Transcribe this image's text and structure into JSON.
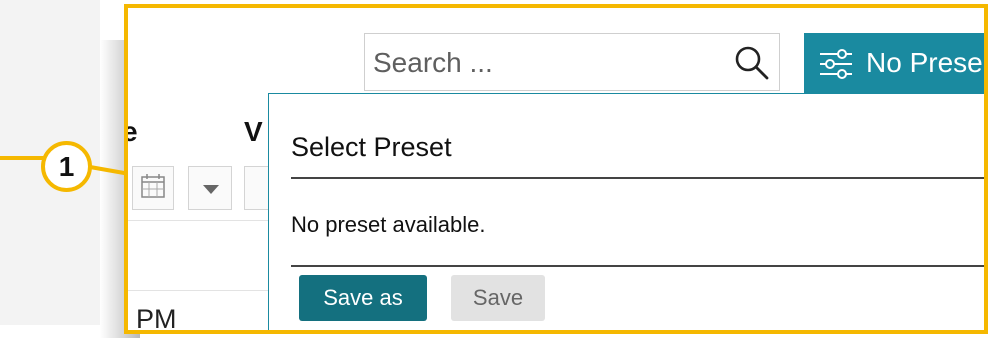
{
  "search": {
    "placeholder": "Search ..."
  },
  "preset_button": {
    "label": "No Prese"
  },
  "table": {
    "column_headers": [
      "e",
      "V"
    ],
    "row_text": "PM"
  },
  "callout": {
    "number": "1"
  },
  "preset_popup": {
    "title": "Select Preset",
    "message": "No preset available.",
    "save_as_label": "Save as",
    "save_label": "Save"
  },
  "icons": {
    "search": "search-icon",
    "filter": "sliders-icon",
    "calendar": "calendar-icon",
    "dropdown": "caret-down-icon"
  },
  "colors": {
    "accent": "#1a8aa0",
    "primary_button": "#14707f",
    "highlight": "#f5b800"
  }
}
